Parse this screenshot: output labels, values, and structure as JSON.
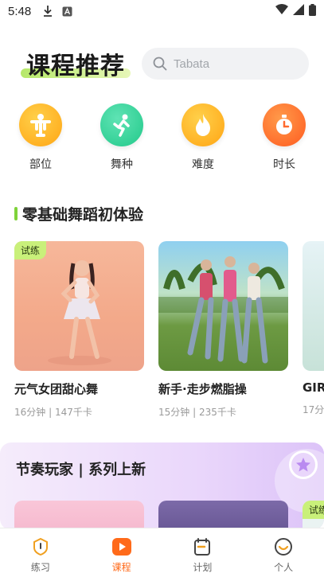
{
  "status_bar": {
    "time": "5:48"
  },
  "header": {
    "title": "课程推荐",
    "search_placeholder": "Tabata"
  },
  "categories": [
    {
      "label": "部位",
      "icon": "body-part-icon",
      "color": "#ffb21e"
    },
    {
      "label": "舞种",
      "icon": "dance-style-icon",
      "color": "#36cf9b"
    },
    {
      "label": "难度",
      "icon": "flame-icon",
      "color": "#ffb21e"
    },
    {
      "label": "时长",
      "icon": "stopwatch-icon",
      "color": "#ff6a2e"
    }
  ],
  "section": {
    "title": "零基础舞蹈初体验",
    "accent": "#7fd33a"
  },
  "courses": [
    {
      "title": "元气女团甜心舞",
      "meta": "16分钟 | 147千卡",
      "badge": "试练"
    },
    {
      "title": "新手·走步燃脂操",
      "meta": "15分钟 | 235千卡",
      "badge": ""
    },
    {
      "title": "GIRL",
      "meta": "17分",
      "badge": ""
    }
  ],
  "banner": {
    "title": "节奏玩家 | 系列上新",
    "card_badge": "试练"
  },
  "bottom_nav": [
    {
      "label": "练习",
      "icon": "practice-icon",
      "active": false
    },
    {
      "label": "课程",
      "icon": "course-play-icon",
      "active": true
    },
    {
      "label": "计划",
      "icon": "calendar-icon",
      "active": false
    },
    {
      "label": "个人",
      "icon": "profile-icon",
      "active": false
    }
  ],
  "colors": {
    "active": "#ff6a1a",
    "badge": "#c9f07a"
  }
}
